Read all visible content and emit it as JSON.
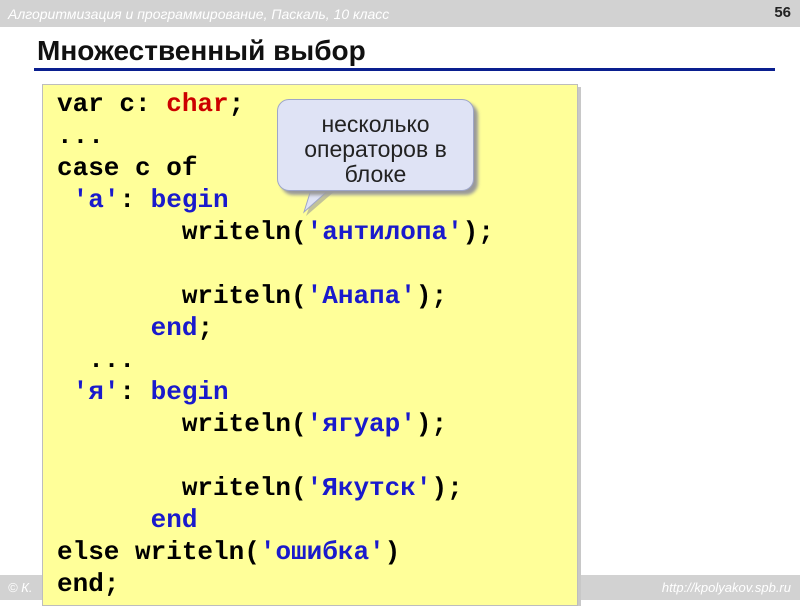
{
  "header": {
    "course": "Алгоритмизация и программирование, Паскаль, 10 класс",
    "slide_number": "56"
  },
  "slide": {
    "title": "Множественный выбор"
  },
  "callout": {
    "line1": "несколько",
    "line2": "операторов в",
    "line3": "блоке"
  },
  "code": {
    "l1_a": "var c: ",
    "l1_b": "char",
    "l1_c": ";",
    "l2": "...",
    "l3": "case c of",
    "l4_a": " ",
    "l4_b": "'а'",
    "l4_c": ": ",
    "l4_d": "begin",
    "l5_a": "        writeln(",
    "l5_b": "'антилопа'",
    "l5_c": ");",
    "l7_a": "        writeln(",
    "l7_b": "'Анапа'",
    "l7_c": ");",
    "l8_a": "      ",
    "l8_b": "end",
    "l8_c": ";",
    "l9": "  ...",
    "l10_a": " ",
    "l10_b": "'я'",
    "l10_c": ": ",
    "l10_d": "begin",
    "l11_a": "        writeln(",
    "l11_b": "'ягуар'",
    "l11_c": ");",
    "l13_a": "        writeln(",
    "l13_b": "'Якутск'",
    "l13_c": ");",
    "l14_a": "      ",
    "l14_b": "end",
    "l15_a": "else writeln(",
    "l15_b": "'ошибка'",
    "l15_c": ")",
    "l16": "end;"
  },
  "footer": {
    "author": "© К.",
    "site": "http://kpolyakov.spb.ru"
  },
  "colors": {
    "accent_rule": "#0a1f8f",
    "code_background": "#ffff99",
    "keyword": "#1a1acc",
    "string": "#cc0000",
    "callout_fill": "#dfe3f5"
  }
}
